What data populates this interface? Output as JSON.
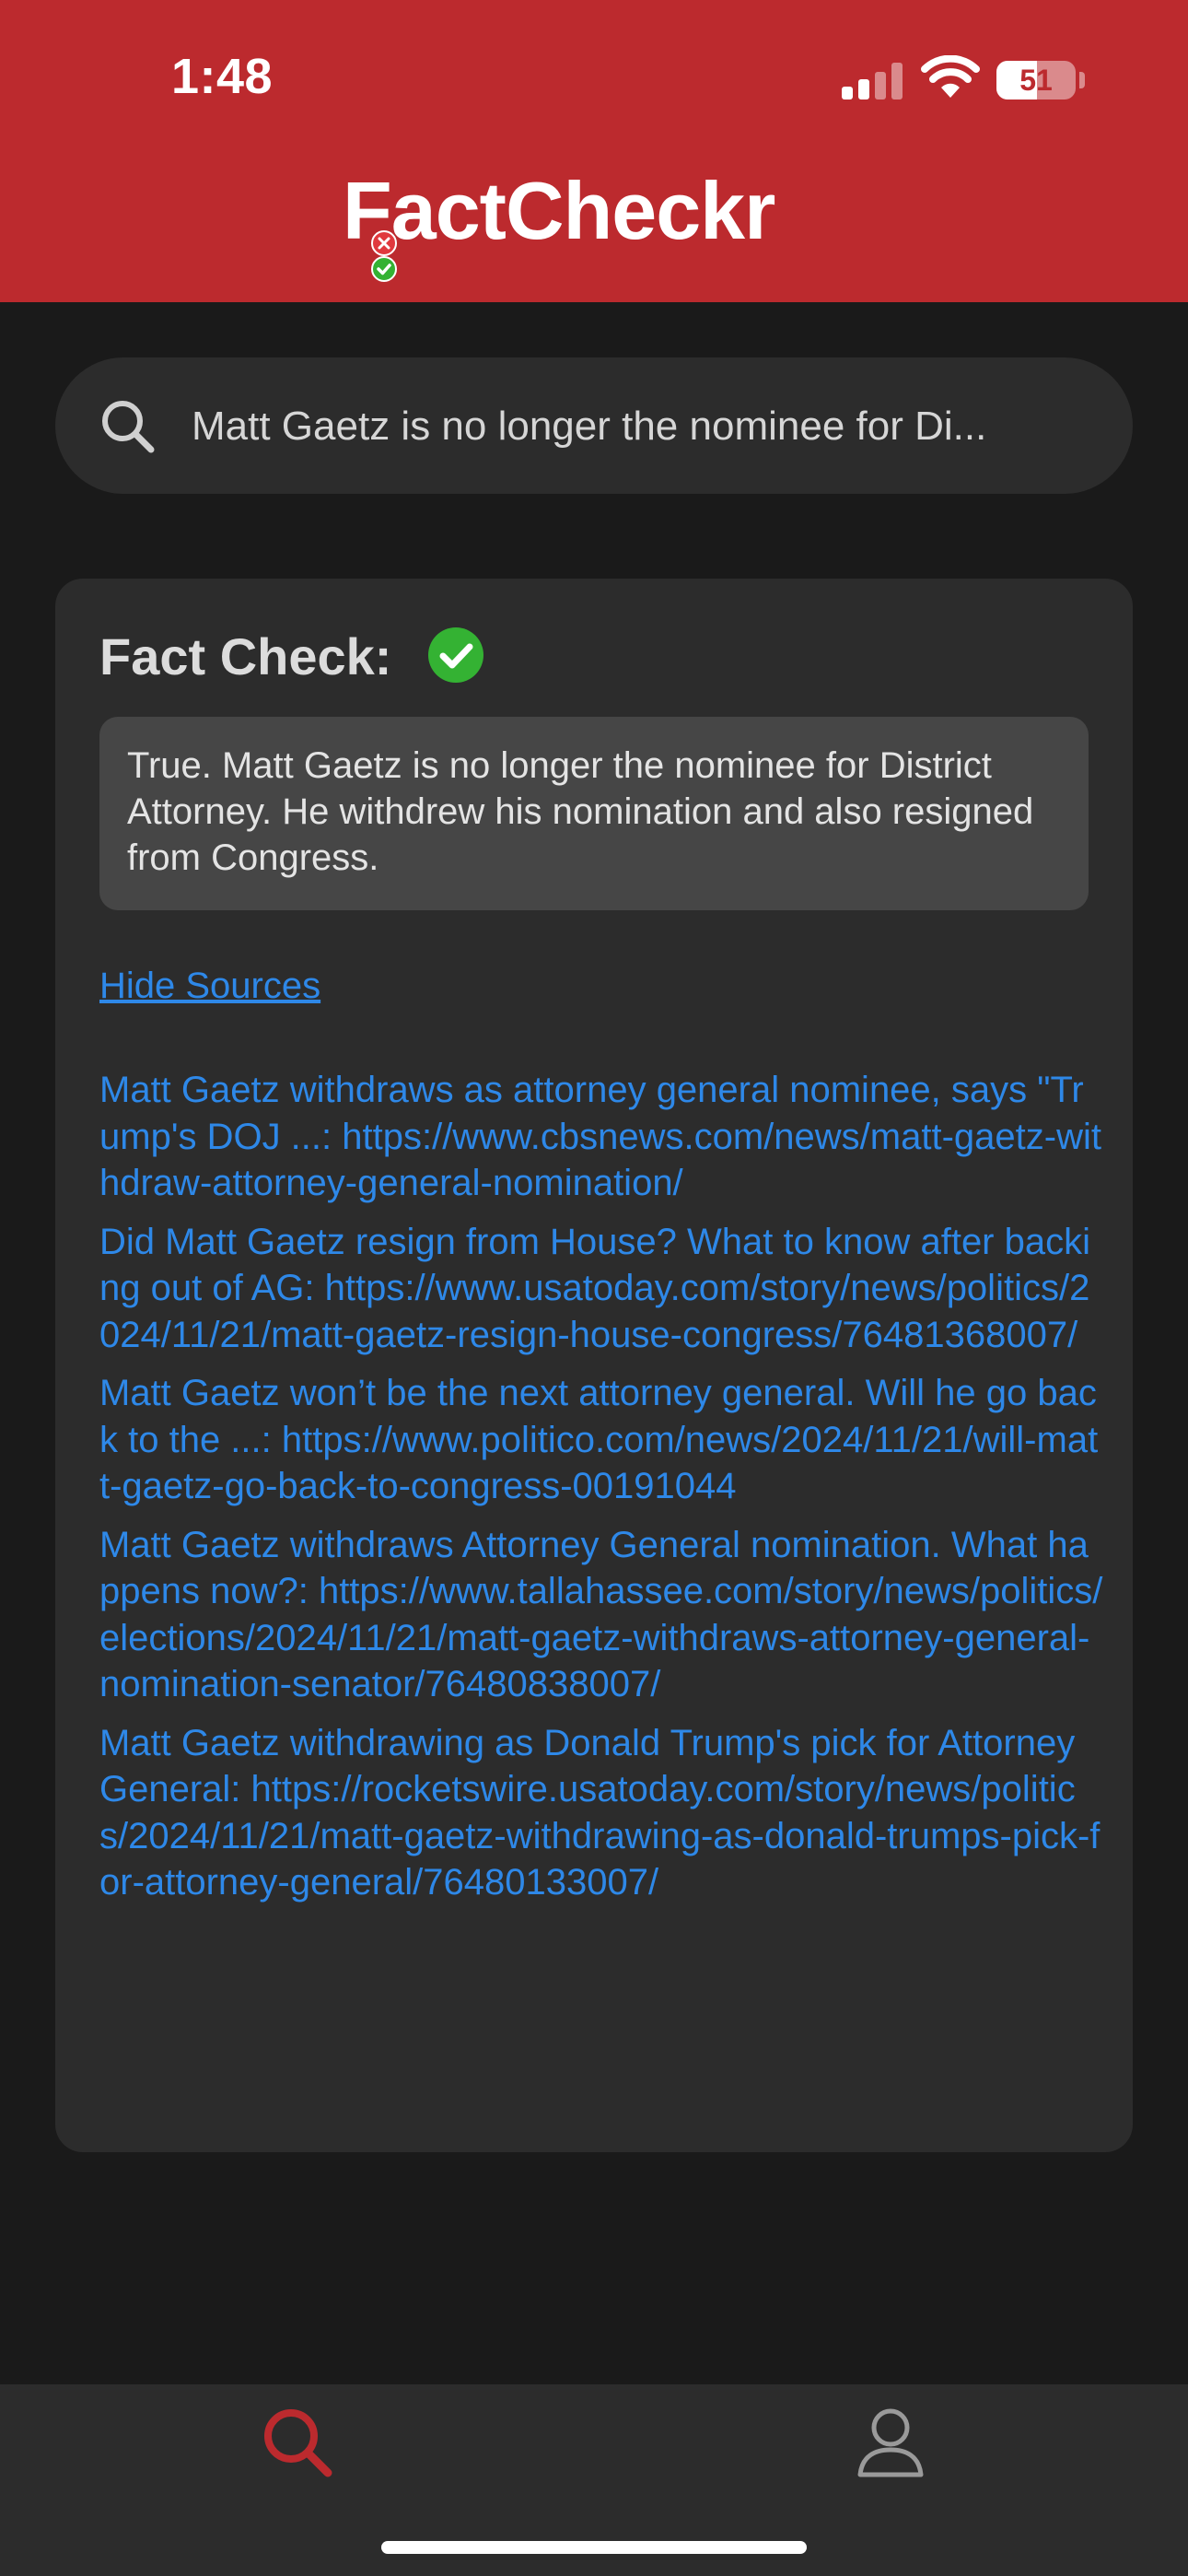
{
  "status_bar": {
    "time": "1:48",
    "battery_percent": "51",
    "battery_level": 0.51,
    "signal_bars_active": 2,
    "signal_bars_total": 4
  },
  "app": {
    "logo_text": "FactCheckr",
    "brand_color": "#bc2a2e"
  },
  "search": {
    "query": "Matt Gaetz is no longer the nominee for Di...",
    "icon": "search-icon"
  },
  "fact_check": {
    "title": "Fact Check:",
    "status_icon": "check-circle-icon",
    "status_color": "#34b233",
    "verdict": "True. Matt Gaetz is no longer the nominee for District Attorney. He withdrew his nomination and also resigned from Congress.",
    "toggle_label": "Hide Sources",
    "link_color": "#2e88e8"
  },
  "sources": [
    "Matt Gaetz withdraws as attorney general nominee, says \"Trump's DOJ ...: https://www.cbsnews.com/news/matt-gaetz-withdraw-attorney-general-nomination/",
    "Did Matt Gaetz resign from House? What to know after backing out of AG: https://www.usatoday.com/story/news/politics/2024/11/21/matt-gaetz-resign-house-congress/76481368007/",
    "Matt Gaetz won’t be the next attorney general. Will he go back to the ...: https://www.politico.com/news/2024/11/21/will-matt-gaetz-go-back-to-congress-00191044",
    "Matt Gaetz withdraws Attorney General nomination. What happens now?: https://www.tallahassee.com/story/news/politics/elections/2024/11/21/matt-gaetz-withdraws-attorney-general-nomination-senator/76480838007/",
    "Matt Gaetz withdrawing as Donald Trump's pick for Attorney General: https://rocketswire.usatoday.com/story/news/politics/2024/11/21/matt-gaetz-withdrawing-as-donald-trumps-pick-for-attorney-general/76480133007/"
  ],
  "tab_bar": {
    "tabs": [
      {
        "icon": "search-icon",
        "active": true
      },
      {
        "icon": "person-icon",
        "active": false
      }
    ]
  }
}
